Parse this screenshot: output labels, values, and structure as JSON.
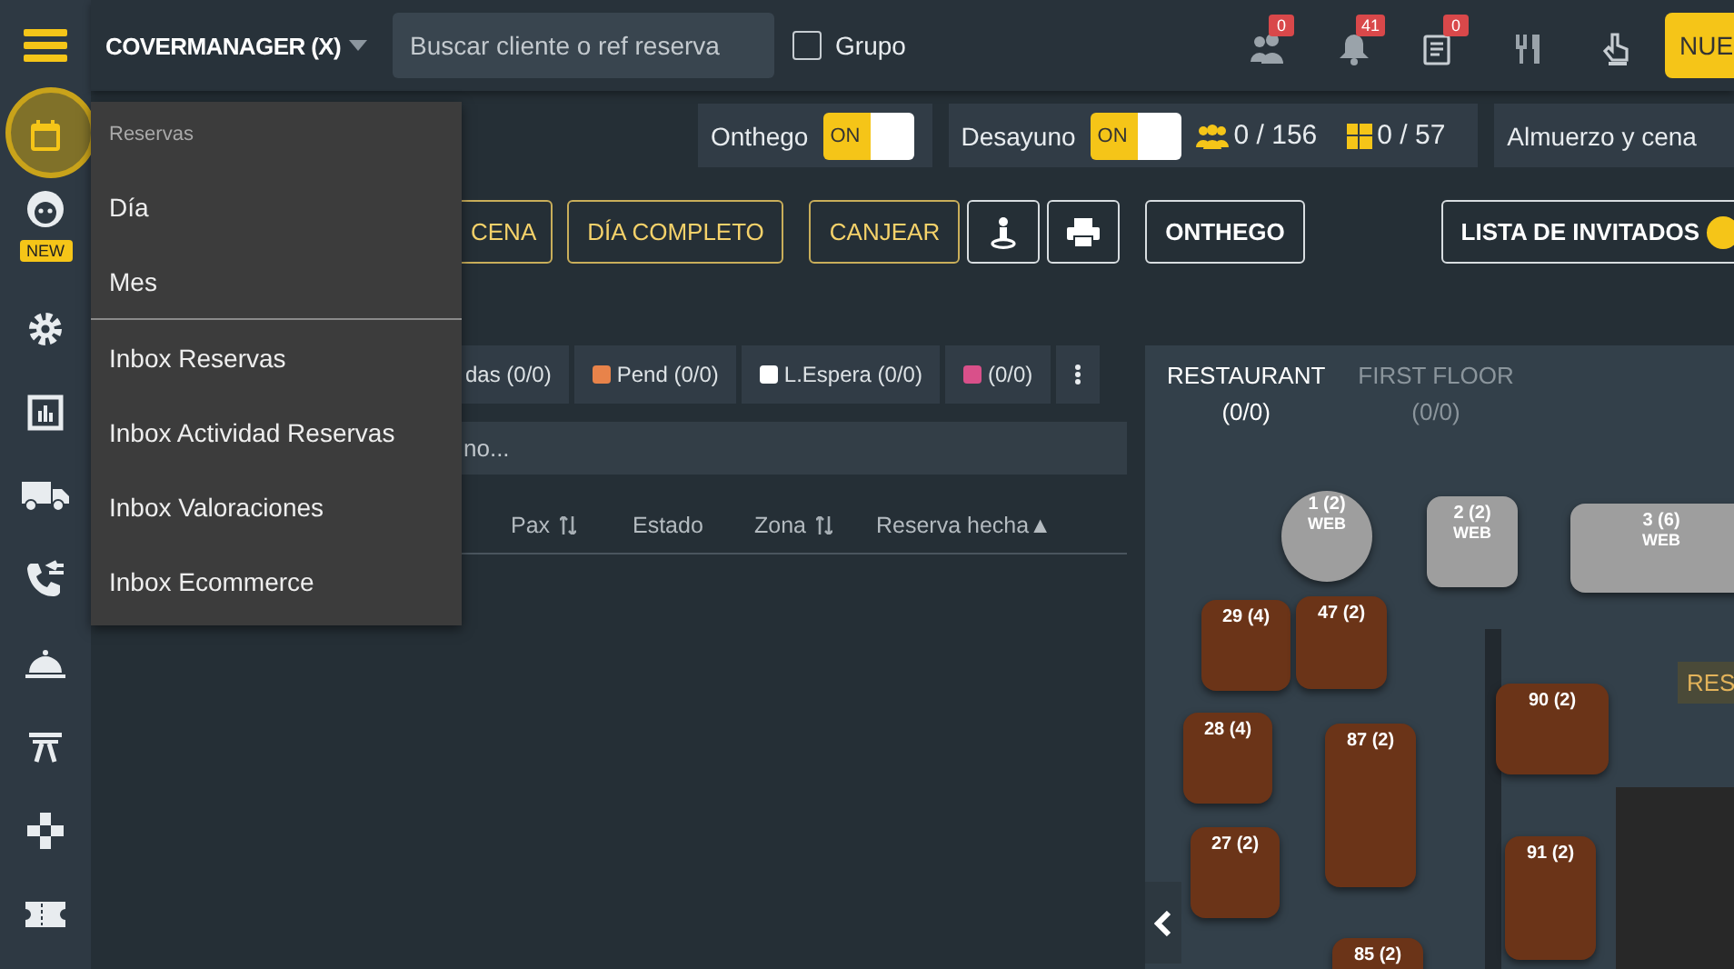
{
  "topbar": {
    "venue": "COVERMANAGER (X)",
    "search": {
      "placeholder": "Buscar cliente o ref reserva"
    },
    "group_checkbox": {
      "label": "Grupo",
      "checked": false
    },
    "tools": [
      {
        "kind": "people",
        "count": "0"
      },
      {
        "kind": "bell",
        "count": "41"
      },
      {
        "kind": "list",
        "count": "0"
      },
      {
        "kind": "cutlery"
      },
      {
        "kind": "hand"
      }
    ],
    "new_button": "NUE"
  },
  "sidebar": {
    "items": [
      {
        "kind": "calendar",
        "selected": true
      },
      {
        "kind": "face",
        "selected": false,
        "badge": "NEW"
      },
      {
        "kind": "gear",
        "selected": false
      },
      {
        "kind": "chart",
        "selected": false
      },
      {
        "kind": "truck",
        "selected": false
      },
      {
        "kind": "phone",
        "selected": false
      },
      {
        "kind": "cloche",
        "selected": false
      },
      {
        "kind": "table",
        "selected": false
      },
      {
        "kind": "puzzle",
        "selected": false
      },
      {
        "kind": "ticket",
        "selected": false
      }
    ]
  },
  "menu": {
    "header": "Reservas",
    "groups": [
      [
        "Día",
        "Mes"
      ],
      [
        "Inbox Reservas",
        "Inbox Actividad Reservas",
        "Inbox Valoraciones",
        "Inbox Ecommerce"
      ]
    ]
  },
  "services": [
    {
      "name": "Onthego",
      "on": true,
      "toggle_label": "ON"
    },
    {
      "name": "Desayuno",
      "on": true,
      "toggle_label": "ON",
      "pax": "0 / 156",
      "tables": "0 / 57"
    },
    {
      "name": "Almuerzo y cena"
    }
  ],
  "actions": [
    {
      "kind": "shift",
      "label": "CENA"
    },
    {
      "kind": "shift",
      "label": "DÍA COMPLETO"
    },
    {
      "kind": "shift",
      "label": "CANJEAR"
    },
    {
      "kind": "person-icon"
    },
    {
      "kind": "print-icon"
    },
    {
      "kind": "plain",
      "label": "ONTHEGO"
    },
    {
      "kind": "plain",
      "label": "LISTA DE INVITADOS",
      "badge": true
    }
  ],
  "filter_tabs": [
    {
      "label": "das (0/0)"
    },
    {
      "label": "Pend (0/0)",
      "color": "#e8834a"
    },
    {
      "label": "L.Espera (0/0)",
      "color": "#ffffff"
    },
    {
      "label": "(0/0)",
      "color": "#d9508a"
    }
  ],
  "filter_field": {
    "placeholder": "no..."
  },
  "columns": [
    {
      "label": "Pax",
      "sortable": true
    },
    {
      "label": "Estado",
      "sortable": false
    },
    {
      "label": "Zona",
      "sortable": true
    },
    {
      "label": "Reserva hecha▲",
      "sortable": false
    }
  ],
  "floor": {
    "tabs": [
      {
        "name": "RESTAURANT",
        "count": "(0/0)",
        "selected": true
      },
      {
        "name": "FIRST FLOOR",
        "count": "(0/0)",
        "selected": false
      }
    ],
    "tables": [
      {
        "label": "1 (2)",
        "sub": "WEB",
        "kind": "round",
        "color": "#9e9e9e"
      },
      {
        "label": "2 (2)",
        "sub": "WEB",
        "kind": "square",
        "color": "#9e9e9e"
      },
      {
        "label": "3 (6)",
        "sub": "WEB",
        "kind": "square",
        "color": "#9e9e9e"
      },
      {
        "label": "29 (4)",
        "kind": "square",
        "color": "#6b3418"
      },
      {
        "label": "47 (2)",
        "kind": "square",
        "color": "#6b3418"
      },
      {
        "label": "28 (4)",
        "kind": "square",
        "color": "#6b3418"
      },
      {
        "label": "87 (2)",
        "kind": "square",
        "color": "#6b3418"
      },
      {
        "label": "27 (2)",
        "kind": "square",
        "color": "#6b3418"
      },
      {
        "label": "90 (2)",
        "kind": "square",
        "color": "#6b3418"
      },
      {
        "label": "91 (2)",
        "kind": "square",
        "color": "#6b3418"
      },
      {
        "label": "85 (2)",
        "kind": "square",
        "color": "#6b3418"
      }
    ],
    "zone_tag": "RES"
  }
}
